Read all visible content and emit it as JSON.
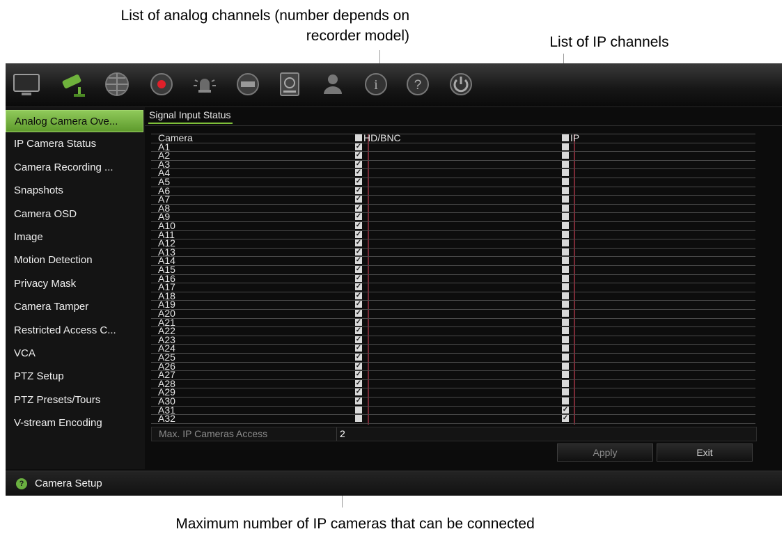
{
  "callouts": {
    "analog_line1": "List of analog channels (number depends on",
    "analog_line2": "recorder model)",
    "ip": "List of IP channels",
    "max": "Maximum number of IP cameras that can be connected"
  },
  "toolbar": {
    "icons": [
      "monitor-icon",
      "camera-icon",
      "network-icon",
      "record-icon",
      "alarm-icon",
      "storage-icon",
      "hdd-icon",
      "user-icon",
      "info-icon",
      "help-icon",
      "power-icon"
    ]
  },
  "sidebar": {
    "active_index": 0,
    "items": [
      {
        "label": "Analog Camera Ove..."
      },
      {
        "label": "IP Camera Status"
      },
      {
        "label": "Camera Recording ..."
      },
      {
        "label": "Snapshots"
      },
      {
        "label": "Camera OSD"
      },
      {
        "label": "Image"
      },
      {
        "label": "Motion Detection"
      },
      {
        "label": "Privacy Mask"
      },
      {
        "label": "Camera Tamper"
      },
      {
        "label": "Restricted Access C..."
      },
      {
        "label": "VCA"
      },
      {
        "label": "PTZ Setup"
      },
      {
        "label": "PTZ Presets/Tours"
      },
      {
        "label": "V-stream Encoding"
      }
    ]
  },
  "tab": {
    "label": "Signal Input Status"
  },
  "table": {
    "headers": {
      "camera": "Camera",
      "hd": "HD/BNC",
      "ip": "IP"
    },
    "rows": [
      {
        "camera": "A1",
        "hd": true,
        "ip": false
      },
      {
        "camera": "A2",
        "hd": true,
        "ip": false
      },
      {
        "camera": "A3",
        "hd": true,
        "ip": false
      },
      {
        "camera": "A4",
        "hd": true,
        "ip": false
      },
      {
        "camera": "A5",
        "hd": true,
        "ip": false
      },
      {
        "camera": "A6",
        "hd": true,
        "ip": false
      },
      {
        "camera": "A7",
        "hd": true,
        "ip": false
      },
      {
        "camera": "A8",
        "hd": true,
        "ip": false
      },
      {
        "camera": "A9",
        "hd": true,
        "ip": false
      },
      {
        "camera": "A10",
        "hd": true,
        "ip": false
      },
      {
        "camera": "A11",
        "hd": true,
        "ip": false
      },
      {
        "camera": "A12",
        "hd": true,
        "ip": false
      },
      {
        "camera": "A13",
        "hd": true,
        "ip": false
      },
      {
        "camera": "A14",
        "hd": true,
        "ip": false
      },
      {
        "camera": "A15",
        "hd": true,
        "ip": false
      },
      {
        "camera": "A16",
        "hd": true,
        "ip": false
      },
      {
        "camera": "A17",
        "hd": true,
        "ip": false
      },
      {
        "camera": "A18",
        "hd": true,
        "ip": false
      },
      {
        "camera": "A19",
        "hd": true,
        "ip": false
      },
      {
        "camera": "A20",
        "hd": true,
        "ip": false
      },
      {
        "camera": "A21",
        "hd": true,
        "ip": false
      },
      {
        "camera": "A22",
        "hd": true,
        "ip": false
      },
      {
        "camera": "A23",
        "hd": true,
        "ip": false
      },
      {
        "camera": "A24",
        "hd": true,
        "ip": false
      },
      {
        "camera": "A25",
        "hd": true,
        "ip": false
      },
      {
        "camera": "A26",
        "hd": true,
        "ip": false
      },
      {
        "camera": "A27",
        "hd": true,
        "ip": false
      },
      {
        "camera": "A28",
        "hd": true,
        "ip": false
      },
      {
        "camera": "A29",
        "hd": true,
        "ip": false
      },
      {
        "camera": "A30",
        "hd": true,
        "ip": false
      },
      {
        "camera": "A31",
        "hd": false,
        "ip": true
      },
      {
        "camera": "A32",
        "hd": false,
        "ip": true
      }
    ]
  },
  "max_ip": {
    "label": "Max. IP Cameras Access",
    "value": "2"
  },
  "buttons": {
    "apply": "Apply",
    "exit": "Exit"
  },
  "status": {
    "label": "Camera Setup"
  },
  "colors": {
    "accent": "#7fc03a",
    "active_nav": "#7cb84a",
    "background": "#0c0c0c"
  }
}
